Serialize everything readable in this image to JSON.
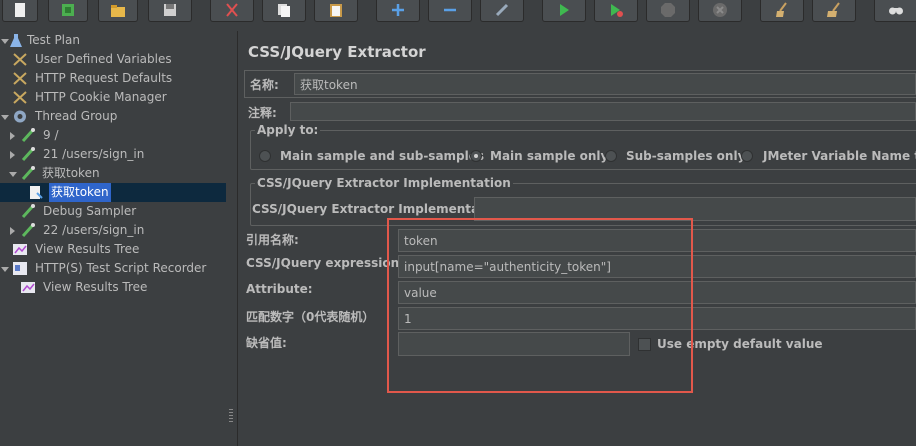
{
  "toolbar": {
    "buttons": [
      "new-icon",
      "templates-icon",
      "open-icon",
      "save-icon",
      "cut-icon",
      "copy-icon",
      "paste-icon",
      "expand-icon",
      "collapse-icon",
      "toggle-icon",
      "start-icon",
      "start-no-pauses-icon",
      "stop-icon",
      "shutdown-icon",
      "clear-icon",
      "clear-all-icon",
      "search-icon"
    ]
  },
  "tree": {
    "items": [
      {
        "label": "Test Plan",
        "icon": "test-plan-icon"
      },
      {
        "label": "User Defined Variables",
        "icon": "config-icon"
      },
      {
        "label": "HTTP Request Defaults",
        "icon": "config-icon"
      },
      {
        "label": "HTTP Cookie Manager",
        "icon": "config-icon"
      },
      {
        "label": "Thread Group",
        "icon": "gear-icon"
      },
      {
        "label": "9 /",
        "icon": "sampler-pipette-icon"
      },
      {
        "label": "21 /users/sign_in",
        "icon": "sampler-pipette-icon"
      },
      {
        "label": "获取token",
        "icon": "sampler-pipette-icon"
      },
      {
        "label": "获取token",
        "icon": "extractor-doc-icon"
      },
      {
        "label": "Debug Sampler",
        "icon": "sampler-pipette-icon"
      },
      {
        "label": "22 /users/sign_in",
        "icon": "sampler-pipette-icon"
      },
      {
        "label": "View Results Tree",
        "icon": "listener-chart-icon"
      },
      {
        "label": "HTTP(S) Test Script Recorder",
        "icon": "recorder-icon"
      },
      {
        "label": "View Results Tree",
        "icon": "listener-chart-icon"
      }
    ]
  },
  "main": {
    "title": "CSS/JQuery Extractor",
    "name_label": "名称:",
    "name_value": "获取token",
    "comment_label": "注释:",
    "comment_value": "",
    "apply_to": {
      "legend": "Apply to:",
      "options": [
        "Main sample and sub-samples",
        "Main sample only",
        "Sub-samples only",
        "JMeter Variable Name to us"
      ],
      "selected": "Main sample only"
    },
    "impl": {
      "legend": "CSS/JQuery Extractor Implementation",
      "label": "CSS/JQuery Extractor Implementation",
      "value": ""
    },
    "fields": {
      "ref_label": "引用名称:",
      "ref_value": "token",
      "expr_label": "CSS/JQuery expression:",
      "expr_value": "input[name=\"authenticity_token\"]",
      "attr_label": "Attribute:",
      "attr_value": "value",
      "match_label": "匹配数字（0代表随机）",
      "match_value": "1",
      "default_label": "缺省值:",
      "default_value": "",
      "use_empty_label": "Use empty default value"
    }
  },
  "colors": {
    "background": "#3c3f41",
    "selection": "#2f65ca",
    "highlight_box": "#e2584b"
  }
}
